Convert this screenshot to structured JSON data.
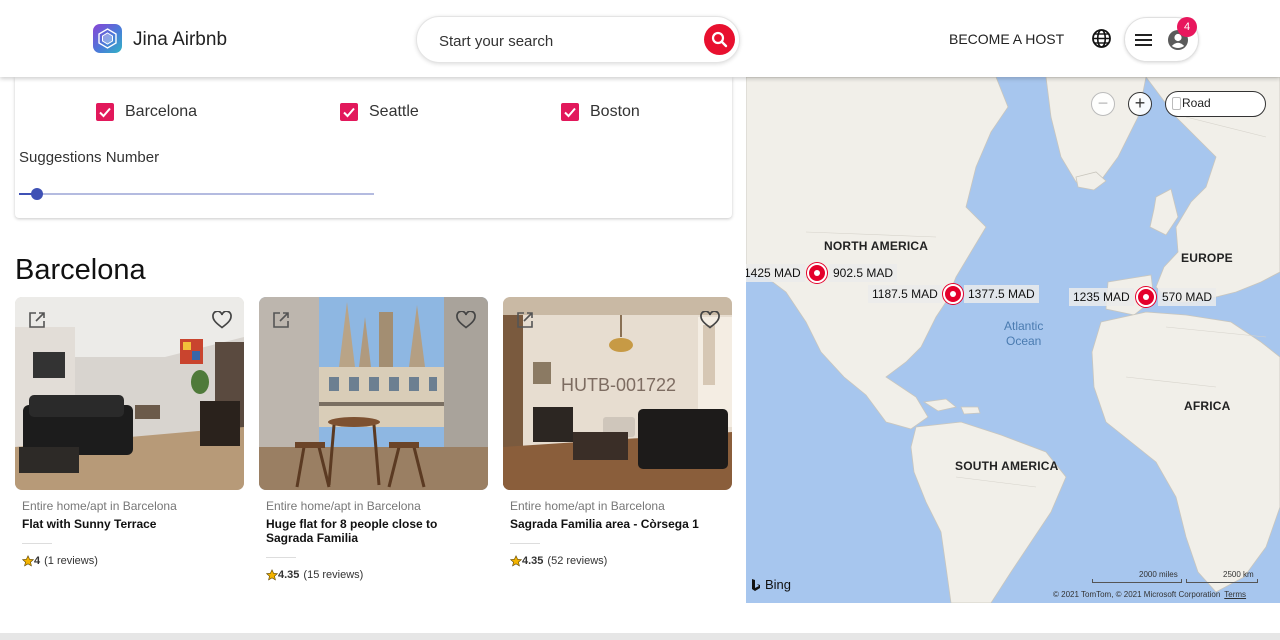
{
  "header": {
    "brand": "Jina Airbnb",
    "search_placeholder": "Start your search",
    "become_host": "BECOME A HOST",
    "notification_count": "4",
    "icons": [
      "logo-icon",
      "search-icon",
      "globe-icon",
      "menu-icon",
      "user-icon"
    ],
    "colors": {
      "brand_red": "#e8102f",
      "badge_pink": "#e8175d"
    }
  },
  "filters": {
    "cities": [
      {
        "label": "Barcelona",
        "checked": true
      },
      {
        "label": "Seattle",
        "checked": true
      },
      {
        "label": "Boston",
        "checked": true
      }
    ],
    "suggestions_label": "Suggestions Number",
    "slider_fraction": 0.05
  },
  "section_title": "Barcelona",
  "listings": [
    {
      "type": "Entire home/apt in Barcelona",
      "title": "Flat with Sunny Terrace",
      "rating": "4",
      "reviews": "(1 reviews)"
    },
    {
      "type": "Entire home/apt in Barcelona",
      "title": "Huge flat for 8 people close to Sagrada Familia",
      "rating": "4.35",
      "reviews": "(15 reviews)"
    },
    {
      "type": "Entire home/apt in Barcelona",
      "title": "Sagrada Familia area - Còrsega 1",
      "rating": "4.35",
      "reviews": "(52 reviews)",
      "watermark": "HUTB-001722"
    }
  ],
  "map": {
    "labels": {
      "north_america": "NORTH AMERICA",
      "south_america": "SOUTH AMERICA",
      "europe": "EUROPE",
      "africa": "AFRICA",
      "atlantic": "Atlantic",
      "ocean": "Ocean"
    },
    "prices": {
      "seattle_left": "1425 MAD",
      "seattle_right": "902.5 MAD",
      "boston_left": "1187.5 MAD",
      "boston_right": "1377.5 MAD",
      "barcelona_left": "1235 MAD",
      "barcelona_right": "570 MAD"
    },
    "style_button": "Road",
    "zoom_in": "+",
    "zoom_out": "−",
    "provider": "Bing",
    "scale_miles": "2000 miles",
    "scale_km": "2500 km",
    "copyright": "© 2021 TomTom, © 2021 Microsoft Corporation",
    "terms": "Terms"
  }
}
